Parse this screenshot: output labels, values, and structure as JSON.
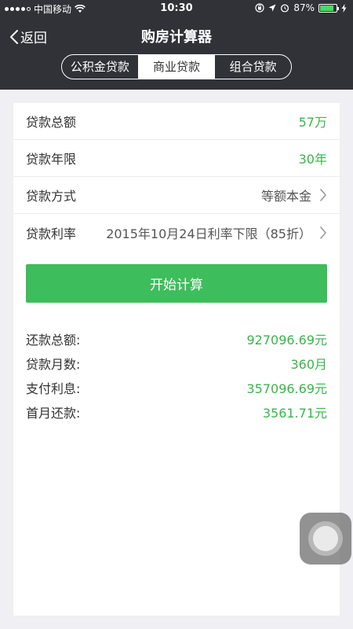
{
  "status_bar": {
    "carrier": "中国移动",
    "time": "10:30",
    "battery": "87%",
    "battery_level": 0.87,
    "icons": [
      "signal-dots-icon",
      "wifi-icon",
      "orientation-lock-icon",
      "location-icon",
      "alarm-icon",
      "battery-icon",
      "charging-icon"
    ]
  },
  "nav": {
    "back_label": "返回",
    "title": "购房计算器"
  },
  "tabs": [
    {
      "label": "公积金贷款",
      "active": false
    },
    {
      "label": "商业贷款",
      "active": true
    },
    {
      "label": "组合贷款",
      "active": false
    }
  ],
  "form": {
    "rows": [
      {
        "label": "贷款总额",
        "value": "57万",
        "style": "green"
      },
      {
        "label": "贷款年限",
        "value": "30年",
        "style": "green"
      },
      {
        "label": "贷款方式",
        "value": "等额本金",
        "style": "gray"
      },
      {
        "label": "贷款利率",
        "value": "2015年10月24日利率下限（85折）",
        "style": "gray"
      }
    ]
  },
  "calculate_button": "开始计算",
  "results": [
    {
      "label": "还款总额:",
      "value": "927096.69元"
    },
    {
      "label": "贷款月数:",
      "value": "360月"
    },
    {
      "label": "支付利息:",
      "value": "357096.69元"
    },
    {
      "label": "首月还款:",
      "value": "3561.71元"
    }
  ],
  "colors": {
    "header_bg": "#303238",
    "accent_green": "#3dbd5c",
    "value_green": "#38b649",
    "page_bg": "#efeff4"
  }
}
